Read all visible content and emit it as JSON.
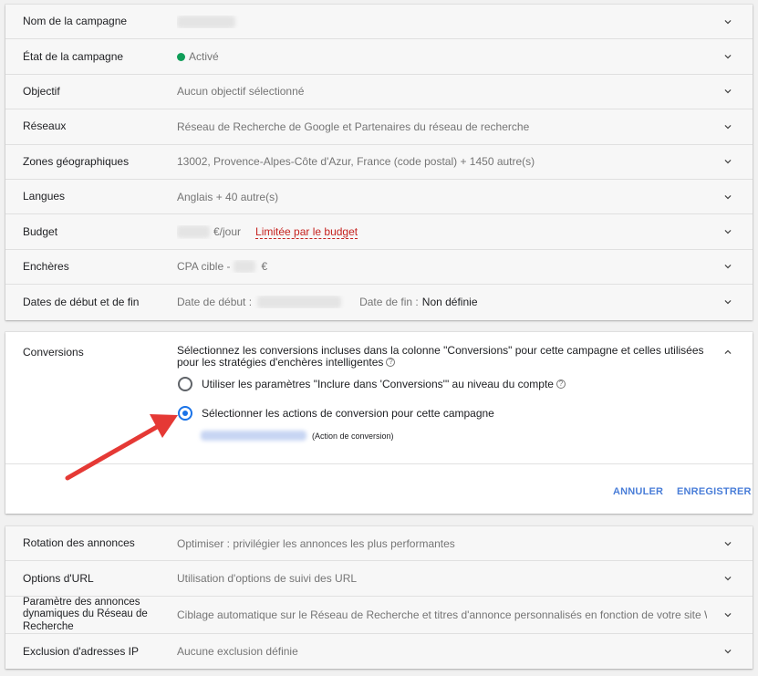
{
  "settings_top": [
    {
      "label": "Nom de la campagne",
      "value": "",
      "type": "blurred"
    },
    {
      "label": "État de la campagne",
      "value": "Activé",
      "type": "status"
    },
    {
      "label": "Objectif",
      "value": "Aucun objectif sélectionné",
      "type": "text"
    },
    {
      "label": "Réseaux",
      "value": "Réseau de Recherche de Google et Partenaires du réseau de recherche",
      "type": "text"
    },
    {
      "label": "Zones géographiques",
      "value": "13002, Provence-Alpes-Côte d'Azur, France (code postal) + 1450 autre(s)",
      "type": "text"
    },
    {
      "label": "Langues",
      "value": "Anglais + 40 autre(s)",
      "type": "text"
    },
    {
      "label": "Budget",
      "value": "€/jour",
      "warning": "Limitée par le budget",
      "type": "budget"
    },
    {
      "label": "Enchères",
      "value": "CPA cible -",
      "suffix": "€",
      "type": "bid"
    },
    {
      "label": "Dates de début et de fin",
      "start_label": "Date de début :",
      "end_label": "Date de fin :",
      "end_value": "Non définie",
      "type": "dates"
    }
  ],
  "conversions": {
    "label": "Conversions",
    "description": "Sélectionnez les conversions incluses dans la colonne \"Conversions\" pour cette campagne et celles utilisées pour les stratégies d'enchères intelligentes",
    "option_account": "Utiliser les paramètres \"Inclure dans 'Conversions'\" au niveau du compte",
    "option_campaign": "Sélectionner les actions de conversion pour cette campagne",
    "selected_option": "option_campaign",
    "action_suffix": "(Action de conversion)",
    "cancel_label": "ANNULER",
    "save_label": "ENREGISTRER"
  },
  "settings_bottom": [
    {
      "label": "Rotation des annonces",
      "value": "Optimiser : privilégier les annonces les plus performantes"
    },
    {
      "label": "Options d'URL",
      "value": "Utilisation d'options de suivi des URL"
    },
    {
      "label": "Paramètre des annonces dynamiques du Réseau de Recherche",
      "value": "Ciblage automatique sur le Réseau de Recherche et titres d'annonce personnalisés en fonction de votre site W"
    },
    {
      "label": "Exclusion d'adresses IP",
      "value": "Aucune exclusion définie"
    }
  ],
  "colors": {
    "accent": "#1a73e8",
    "button_text": "#4a7ed8",
    "status_green": "#0f9d58",
    "warning_red": "#c5221f",
    "annotation_arrow": "#e53935"
  },
  "icons": {
    "expand": "chevron-down-icon",
    "collapse": "chevron-up-icon",
    "help": "help-circle-icon"
  }
}
